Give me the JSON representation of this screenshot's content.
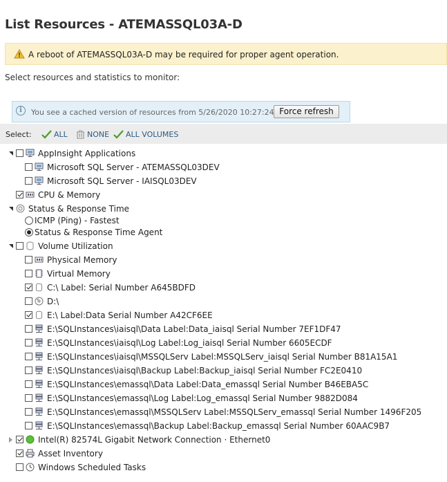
{
  "page": {
    "title": "List Resources - ATEMASSQL03A-D",
    "warning": "A reboot of ATEMASSQL03A-D may be required for proper agent operation.",
    "instructions": "Select resources and statistics to monitor:",
    "cached_notice": "You see a cached version of resources from 5/26/2020 10:27:24 AM.",
    "force_refresh": "Force refresh"
  },
  "select_bar": {
    "label": "Select:",
    "all": "ALL",
    "none": "NONE",
    "all_volumes": "ALL VOLUMES"
  },
  "tree": [
    {
      "label": "AppInsight Applications",
      "checked": false,
      "icon": "monitor-icon",
      "expanded": true
    },
    {
      "label": "Microsoft SQL Server - ATEMASSQL03DEV",
      "checked": false,
      "icon": "monitor-icon"
    },
    {
      "label": "Microsoft SQL Server - IAISQL03DEV",
      "checked": false,
      "icon": "monitor-icon"
    },
    {
      "label": "CPU & Memory",
      "checked": true,
      "icon": "memory-chip-icon"
    },
    {
      "label": "Status & Response Time",
      "icon": "status-icon",
      "expanded": true
    },
    {
      "label": "ICMP (Ping) - Fastest",
      "selected": false
    },
    {
      "label": "Status & Response Time Agent",
      "selected": true
    },
    {
      "label": "Volume Utilization",
      "checked": false,
      "icon": "volume-icon",
      "expanded": true
    },
    {
      "label": "Physical Memory",
      "checked": false,
      "icon": "memory-chip-icon"
    },
    {
      "label": "Virtual Memory",
      "checked": false,
      "icon": "virtual-memory-icon"
    },
    {
      "label": "C:\\ Label: Serial Number A645BDFD",
      "checked": true,
      "icon": "disk-icon"
    },
    {
      "label": "D:\\",
      "checked": false,
      "icon": "cd-drive-icon"
    },
    {
      "label": "E:\\ Label:Data Serial Number A42CF6EE",
      "checked": true,
      "icon": "disk-icon"
    },
    {
      "label": "E:\\SQLInstances\\iaisql\\Data Label:Data_iaisql Serial Number 7EF1DF47",
      "checked": false,
      "icon": "network-drive-icon"
    },
    {
      "label": "E:\\SQLInstances\\iaisql\\Log Label:Log_iaisql Serial Number 6605ECDF",
      "checked": false,
      "icon": "network-drive-icon"
    },
    {
      "label": "E:\\SQLInstances\\iaisql\\MSSQLServ Label:MSSQLServ_iaisql Serial Number B81A15A1",
      "checked": false,
      "icon": "network-drive-icon"
    },
    {
      "label": "E:\\SQLInstances\\iaisql\\Backup Label:Backup_iaisql Serial Number FC2E0410",
      "checked": false,
      "icon": "network-drive-icon"
    },
    {
      "label": "E:\\SQLInstances\\emassql\\Data Label:Data_emassql Serial Number B46EBA5C",
      "checked": false,
      "icon": "network-drive-icon"
    },
    {
      "label": "E:\\SQLInstances\\emassql\\Log Label:Log_emassql Serial Number 9882D084",
      "checked": false,
      "icon": "network-drive-icon"
    },
    {
      "label": "E:\\SQLInstances\\emassql\\MSSQLServ Label:MSSQLServ_emassql Serial Number 1496F205",
      "checked": false,
      "icon": "network-drive-icon"
    },
    {
      "label": "E:\\SQLInstances\\emassql\\Backup Label:Backup_emassql Serial Number 60AAC9B7",
      "checked": false,
      "icon": "network-drive-icon"
    },
    {
      "label": "Intel(R) 82574L Gigabit Network Connection · Ethernet0",
      "checked": true,
      "icon": "status-up-icon",
      "expanded": false
    },
    {
      "label": "Asset Inventory",
      "checked": true,
      "icon": "printer-icon"
    },
    {
      "label": "Windows Scheduled Tasks",
      "checked": false,
      "icon": "clock-icon"
    }
  ],
  "colors": {
    "warning_bg": "#fcf1cd",
    "info_bg": "#e3f0f8",
    "link": "#2a5b86",
    "status_up": "#4caf50"
  }
}
